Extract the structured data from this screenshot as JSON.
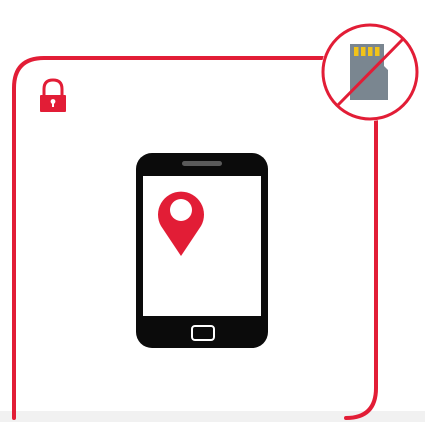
{
  "illustration": {
    "colors": {
      "accent_red": "#e21d36",
      "phone_body": "#0b0b0b",
      "screen": "#ffffff",
      "sd_card": "#7a8690",
      "sd_pins": "#f2c318",
      "background": "#ffffff",
      "bottom_band": "#f1f1f1"
    },
    "icons": {
      "lock": "padlock-icon",
      "phone": "smartphone-icon",
      "location": "location-pin-icon",
      "sd_card": "sd-card-icon",
      "prohibited": "no-sign-icon"
    }
  }
}
